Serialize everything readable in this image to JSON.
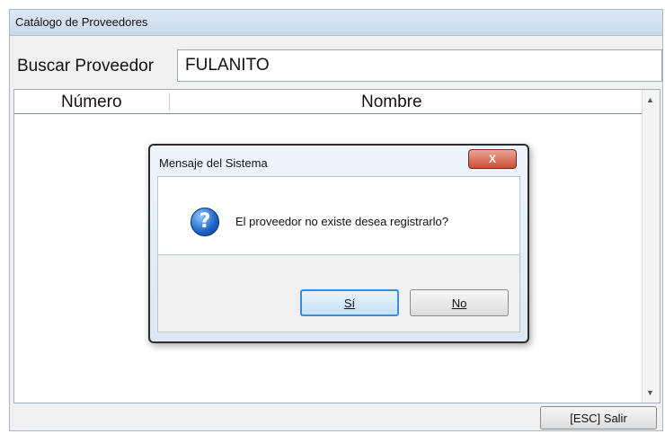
{
  "window": {
    "title": "Catálogo de Proveedores"
  },
  "search": {
    "label": "Buscar Proveedor",
    "value": "FULANITO"
  },
  "grid": {
    "columns": [
      "Número",
      "Nombre"
    ],
    "rows": [],
    "scroll_up": "▲",
    "scroll_down": "▼"
  },
  "footer": {
    "exit_label": "[ESC] Salir"
  },
  "dialog": {
    "title": "Mensaje del Sistema",
    "close_glyph": "X",
    "icon": "question-icon",
    "icon_glyph": "?",
    "message": "El proveedor no existe desea registrarlo?",
    "yes_label": "Sí",
    "no_label": "No"
  }
}
